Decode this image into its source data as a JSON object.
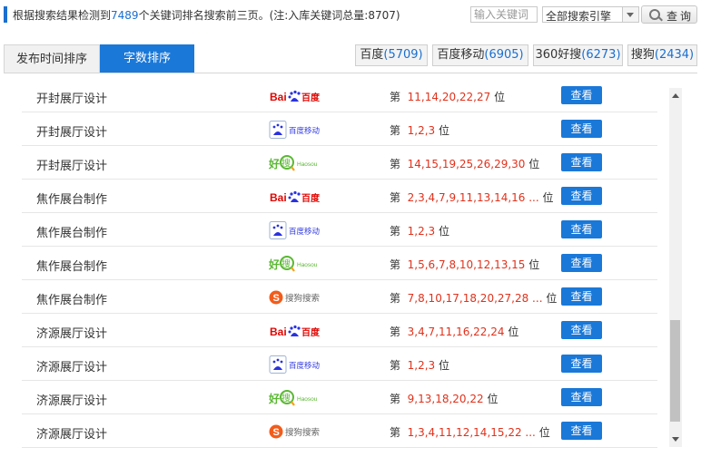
{
  "header": {
    "summary_prefix": "根据搜索结果检测到",
    "keyword_count": "7489",
    "summary_suffix": "个关键词排名搜索前三页。(注:入库关键词总量:8707)",
    "keyword_input_placeholder": "输入关键词",
    "engine_select_value": "全部搜索引擎",
    "search_button_label": "查询"
  },
  "tabs": [
    {
      "label": "发布时间排序",
      "active": false
    },
    {
      "label": "字数排序",
      "active": true
    }
  ],
  "engine_filters": [
    {
      "name": "百度",
      "count": "(5709)"
    },
    {
      "name": "百度移动",
      "count": "(6905)"
    },
    {
      "name": "360好搜",
      "count": "(6273)"
    },
    {
      "name": "搜狗",
      "count": "(2434)"
    }
  ],
  "rows": [
    {
      "keyword": "开封展厅设计",
      "engine": "baidu",
      "rank_prefix": "第",
      "positions": "11,14,20,22,27",
      "rank_suffix": "位",
      "button": "查看"
    },
    {
      "keyword": "开封展厅设计",
      "engine": "baidu-mobile",
      "rank_prefix": "第",
      "positions": "1,2,3",
      "rank_suffix": "位",
      "button": "查看"
    },
    {
      "keyword": "开封展厅设计",
      "engine": "haosou",
      "rank_prefix": "第",
      "positions": "14,15,19,25,26,29,30",
      "rank_suffix": "位",
      "button": "查看"
    },
    {
      "keyword": "焦作展台制作",
      "engine": "baidu",
      "rank_prefix": "第",
      "positions": "2,3,4,7,9,11,13,14,16 ...",
      "rank_suffix": "位",
      "button": "查看"
    },
    {
      "keyword": "焦作展台制作",
      "engine": "baidu-mobile",
      "rank_prefix": "第",
      "positions": "1,2,3",
      "rank_suffix": "位",
      "button": "查看"
    },
    {
      "keyword": "焦作展台制作",
      "engine": "haosou",
      "rank_prefix": "第",
      "positions": "1,5,6,7,8,10,12,13,15",
      "rank_suffix": "位",
      "button": "查看"
    },
    {
      "keyword": "焦作展台制作",
      "engine": "sogou",
      "rank_prefix": "第",
      "positions": "7,8,10,17,18,20,27,28 ...",
      "rank_suffix": "位",
      "button": "查看"
    },
    {
      "keyword": "济源展厅设计",
      "engine": "baidu",
      "rank_prefix": "第",
      "positions": "3,4,7,11,16,22,24",
      "rank_suffix": "位",
      "button": "查看"
    },
    {
      "keyword": "济源展厅设计",
      "engine": "baidu-mobile",
      "rank_prefix": "第",
      "positions": "1,2,3",
      "rank_suffix": "位",
      "button": "查看"
    },
    {
      "keyword": "济源展厅设计",
      "engine": "haosou",
      "rank_prefix": "第",
      "positions": "9,13,18,20,22",
      "rank_suffix": "位",
      "button": "查看"
    },
    {
      "keyword": "济源展厅设计",
      "engine": "sogou",
      "rank_prefix": "第",
      "positions": "1,3,4,11,12,14,15,22 ...",
      "rank_suffix": "位",
      "button": "查看"
    }
  ],
  "logo_texts": {
    "baidu": {
      "left": "Bai",
      "right": "百度"
    },
    "baidu_mobile": {
      "text": "百度移动"
    },
    "haosou": {
      "cn_a": "好",
      "cn_b": "搜",
      "en": "Haosou"
    },
    "sogou": {
      "text": "搜狗搜索"
    }
  },
  "colors": {
    "accent": "#1a78d8",
    "rank_red": "#e0321c",
    "count_blue": "#1a6fd0",
    "baidu_red": "#e10602",
    "baidu_blue": "#2932e1",
    "haosou_green": "#5bb834",
    "sogou_orange": "#f25c1b"
  }
}
